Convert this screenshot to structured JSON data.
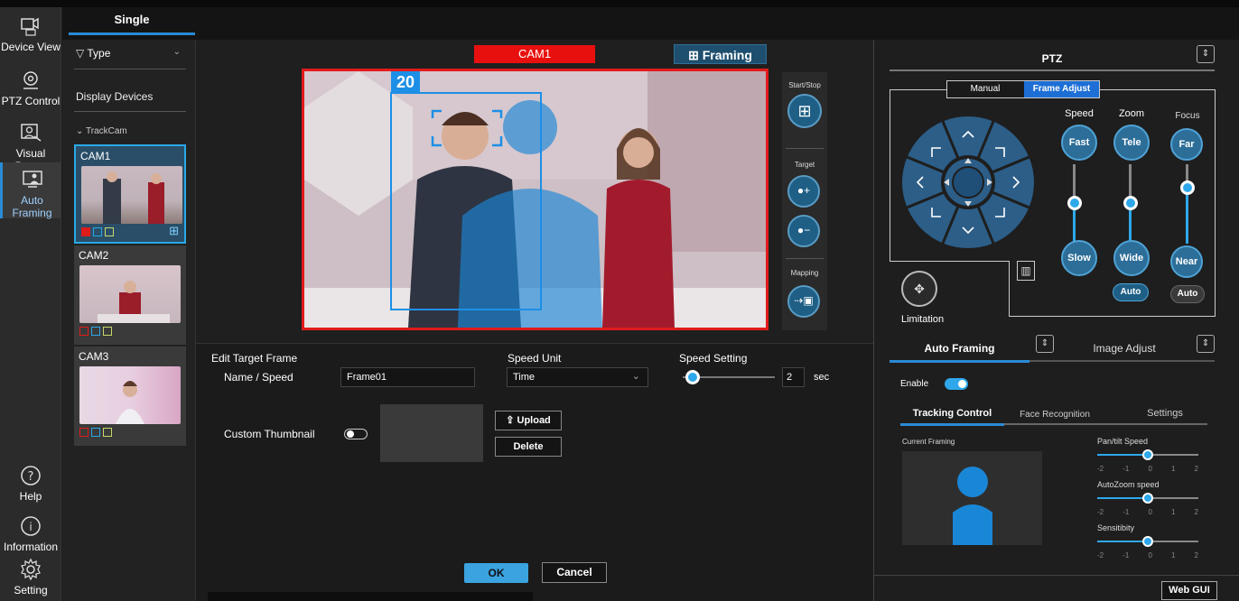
{
  "nav": {
    "items": [
      {
        "label": "Device View"
      },
      {
        "label": "PTZ Control"
      },
      {
        "label": "Visual Preset"
      },
      {
        "label": "Auto Framing"
      },
      {
        "label": "Help"
      },
      {
        "label": "Information"
      },
      {
        "label": "Setting"
      }
    ]
  },
  "header": {
    "tab_single": "Single"
  },
  "devices": {
    "filter_label": "Type",
    "section_title": "Display Devices",
    "group_name": "TrackCam",
    "cams": [
      {
        "name": "CAM1"
      },
      {
        "name": "CAM2"
      },
      {
        "name": "CAM3"
      }
    ]
  },
  "view": {
    "cam_label": "CAM1",
    "framing_label": "Framing",
    "frame_number": "20",
    "start_stop_label": "Start/Stop",
    "target_label": "Target",
    "mapping_label": "Mapping"
  },
  "edit": {
    "title": "Edit Target Frame",
    "name_speed_label": "Name / Speed",
    "name_value": "Frame01",
    "speed_unit_label": "Speed Unit",
    "speed_unit_value": "Time",
    "speed_setting_label": "Speed Setting",
    "speed_value": "2",
    "speed_unit_suffix": "sec",
    "speed_position": 0.05,
    "custom_thumbnail_label": "Custom Thumbnail",
    "custom_thumbnail_enabled": false,
    "upload_label": "Upload",
    "delete_label": "Delete",
    "ok_label": "OK",
    "cancel_label": "Cancel"
  },
  "ptz": {
    "title": "PTZ",
    "tab_manual": "Manual",
    "tab_frame_adjust": "Frame Adjust",
    "speed_label": "Speed",
    "zoom_label": "Zoom",
    "focus_label": "Focus",
    "fast": "Fast",
    "slow": "Slow",
    "tele": "Tele",
    "wide": "Wide",
    "far": "Far",
    "near": "Near",
    "auto": "Auto",
    "limitation_label": "Limitation",
    "speed_level": 0.5,
    "zoom_level": 0.5,
    "focus_level": 0.7
  },
  "auto_framing": {
    "tab_auto_framing": "Auto Framing",
    "tab_image_adjust": "Image Adjust",
    "enable_label": "Enable",
    "enabled": true,
    "sub_tabs": [
      "Tracking Control",
      "Face Recognition",
      "Settings"
    ],
    "current_framing_label": "Current Framing",
    "sliders": [
      {
        "label": "Pan/tilt Speed",
        "value": 0
      },
      {
        "label": "AutoZoom speed",
        "value": 0
      },
      {
        "label": "Sensitibity",
        "value": 0
      }
    ],
    "tick_labels": [
      "-2",
      "-1",
      "0",
      "1",
      "2"
    ]
  },
  "footer": {
    "web_gui": "Web GUI"
  },
  "colors": {
    "accent": "#2a8bd6",
    "alert": "#e8100f",
    "panel": "#1e1e1e"
  }
}
